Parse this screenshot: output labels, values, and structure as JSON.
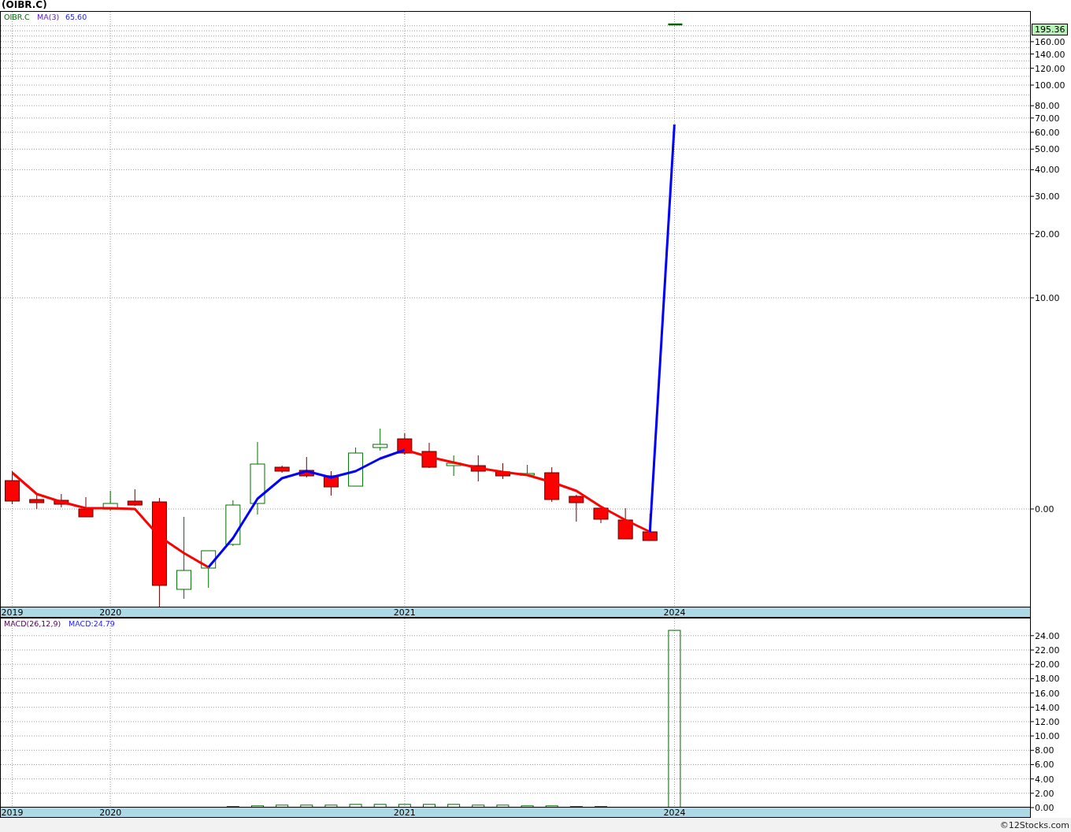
{
  "title": "(OIBR.C)",
  "price_panel": {
    "legend": [
      "OIBR.C",
      "MA(3)",
      "65.60"
    ],
    "last_price": "195.36",
    "y_axis_labels": [
      "160.00",
      "140.00",
      "120.00",
      "100.00",
      "80.00",
      "70.00",
      "60.00",
      "50.00",
      "40.00",
      "30.00",
      "20.00",
      "10.00",
      "0.00"
    ],
    "x_axis_labels": [
      "2019",
      "2020",
      "2021",
      "2024"
    ]
  },
  "macd_panel": {
    "legend": [
      "MACD(26,12,9)",
      "MACD:24.79"
    ],
    "chart_data": {
      "type": "bar",
      "categories": [
        "2019",
        null,
        null,
        null,
        "2020",
        null,
        null,
        null,
        null,
        null,
        null,
        null,
        null,
        null,
        null,
        null,
        "2021",
        null,
        null,
        null,
        null,
        null,
        null,
        null,
        null,
        null,
        null,
        "2024",
        null,
        null,
        null,
        null,
        null,
        null,
        null,
        null,
        null,
        null,
        null,
        null,
        null,
        null
      ],
      "values": [
        null,
        null,
        null,
        null,
        null,
        null,
        null,
        null,
        null,
        0.2,
        0.3,
        0.4,
        0.4,
        0.4,
        0.5,
        0.5,
        0.5,
        0.5,
        0.5,
        0.4,
        0.4,
        0.3,
        0.3,
        0.2,
        0.2,
        null,
        null,
        24.8,
        null,
        null,
        null,
        null,
        null,
        null,
        null,
        null,
        null,
        null,
        null,
        null,
        null,
        null
      ],
      "ylim": [
        0,
        26.4
      ],
      "grid": true,
      "yticks": [
        {
          "value": 24,
          "label": "24.00"
        },
        {
          "value": 22,
          "label": "22.00"
        },
        {
          "value": 20,
          "label": "20.00"
        },
        {
          "value": 18,
          "label": "18.00"
        },
        {
          "value": 16,
          "label": "16.00"
        },
        {
          "value": 14,
          "label": "14.00"
        },
        {
          "value": 12,
          "label": "12.00"
        },
        {
          "value": 10,
          "label": "10.00"
        },
        {
          "value": 8,
          "label": "8.00"
        },
        {
          "value": 6,
          "label": "6.00"
        },
        {
          "value": 4,
          "label": "4.00"
        },
        {
          "value": 2,
          "label": "2.00"
        },
        {
          "value": 0,
          "label": "0.00"
        }
      ]
    }
  },
  "footer": "©12Stocks.com"
}
